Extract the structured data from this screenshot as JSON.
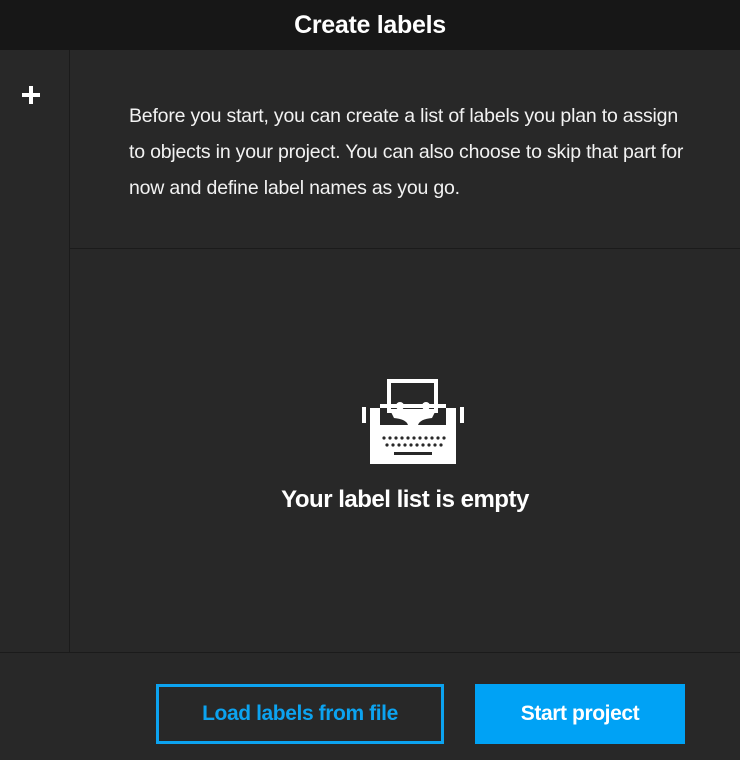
{
  "header": {
    "title": "Create labels"
  },
  "sidebar": {
    "add_icon": "plus-icon"
  },
  "description": {
    "text": "Before you start, you can create a list of labels you plan to assign to objects in your project. You can also choose to skip that part for now and define label names as you go."
  },
  "empty_state": {
    "icon": "typewriter-icon",
    "message": "Your label list is empty"
  },
  "footer": {
    "load_label": "Load labels from file",
    "start_label": "Start project"
  },
  "colors": {
    "background": "#282828",
    "title_bar": "#171717",
    "accent": "#00a2f5",
    "text": "#ffffff"
  }
}
